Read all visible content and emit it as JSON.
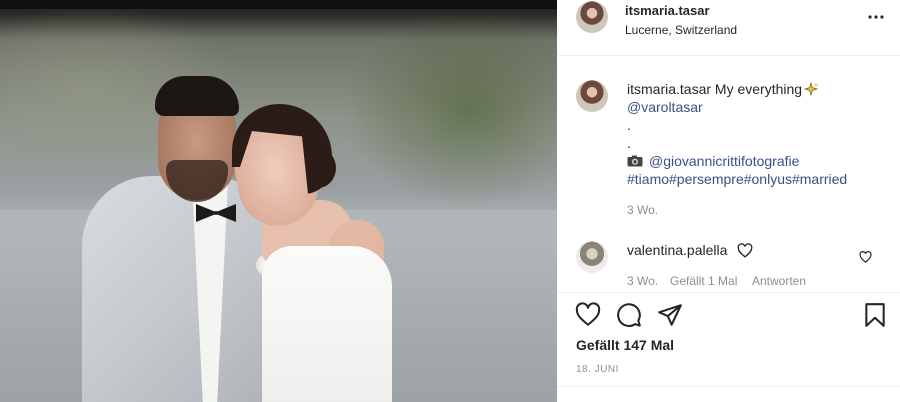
{
  "post": {
    "username": "itsmaria.tasar",
    "location": "Lucerne, Switzerland"
  },
  "caption": {
    "username": "itsmaria.tasar",
    "text": "My everything",
    "mention": "@varoltasar",
    "dot1": ".",
    "dot2": ".",
    "photographer": "@giovannicrittifotografie",
    "hashtags": "#tiamo#persempre#onlyus#married",
    "age": "3 Wo."
  },
  "comment": {
    "username": "valentina.palella",
    "age": "3 Wo.",
    "likes": "Gefällt 1 Mal",
    "reply": "Antworten"
  },
  "footer": {
    "likes": "Gefällt 147 Mal",
    "date": "18. JUNI"
  },
  "icons": {
    "more": "more-options-icon",
    "camera": "camera-icon",
    "sparkle": "sparkle-icon",
    "like": "heart-icon",
    "comment": "comment-icon",
    "share": "share-icon",
    "save": "bookmark-icon"
  },
  "colors": {
    "text": "#262626",
    "muted": "#8e8e8e",
    "link": "#385185",
    "divider": "#efefef"
  }
}
